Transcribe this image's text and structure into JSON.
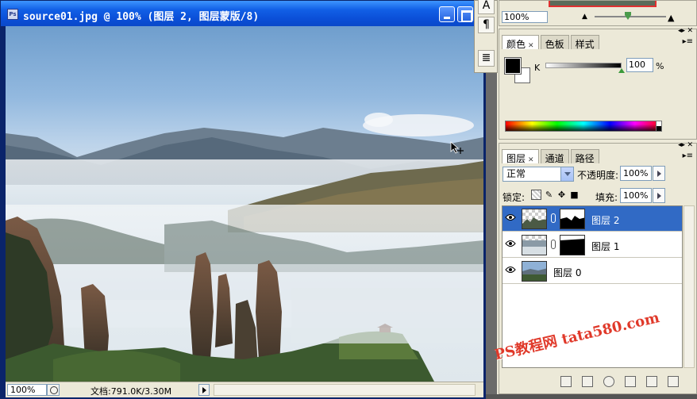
{
  "document": {
    "title": "source01.jpg @ 100% (图层 2, 图层蒙版/8)",
    "zoom": "100%",
    "doc_info": "文档:791.0K/3.30M"
  },
  "mini_toolbar": {
    "items": [
      "A",
      "¶",
      "≣"
    ]
  },
  "navigator": {
    "zoom": "100%"
  },
  "color_panel": {
    "tabs": [
      "颜色",
      "色板",
      "样式"
    ],
    "channel_label": "K",
    "channel_value": "100",
    "unit": "%"
  },
  "layers_panel": {
    "tabs": [
      "图层",
      "通道",
      "路径"
    ],
    "blend_mode": "正常",
    "opacity_label": "不透明度:",
    "opacity_value": "100%",
    "lock_label": "锁定:",
    "fill_label": "填充:",
    "fill_value": "100%",
    "layers": [
      {
        "name": "图层 2",
        "selected": true
      },
      {
        "name": "图层 1",
        "selected": false
      },
      {
        "name": "图层 0",
        "selected": false
      }
    ]
  },
  "watermark": "PS教程网 tata580.com"
}
